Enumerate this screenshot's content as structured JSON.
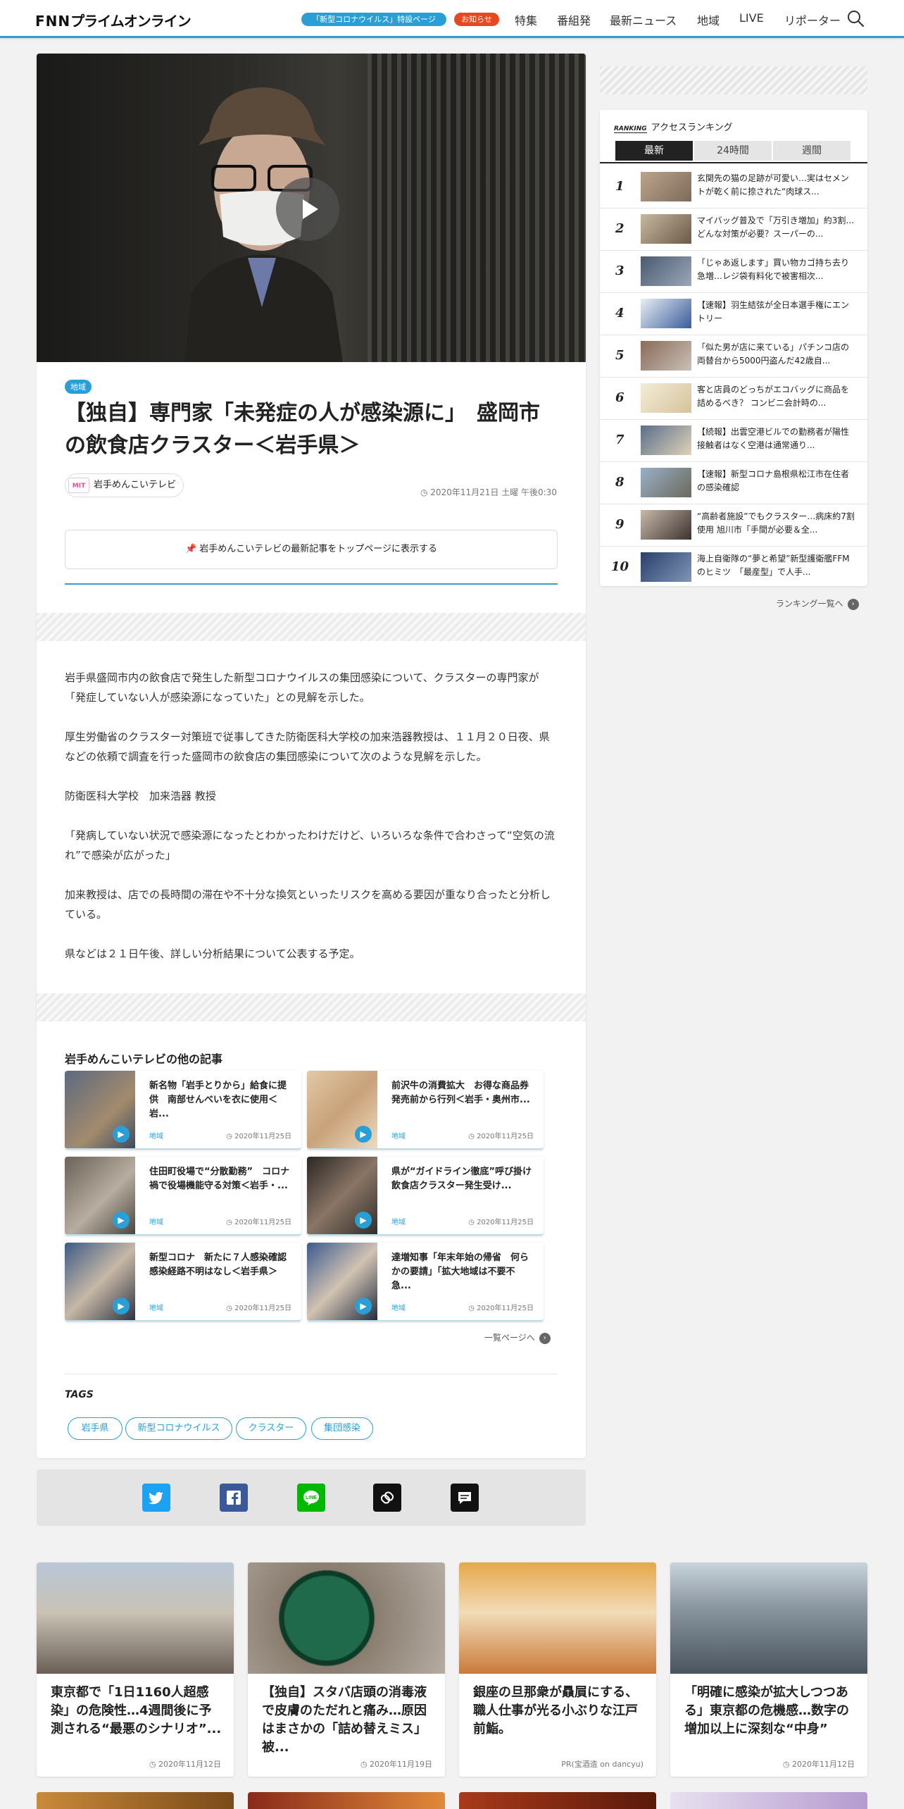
{
  "header": {
    "logo_fnn": "FNN",
    "logo_text": "プライムオンライン",
    "pill_corona": "「新型コロナウイルス」特設ページ",
    "pill_notice": "お知らせ",
    "nav": [
      "特集",
      "番組発",
      "最新ニュース",
      "地域",
      "LIVE",
      "リポーター"
    ]
  },
  "article": {
    "category": "地域",
    "title": "【独自】専門家「未発症の人が感染源に」　盛岡市の飲食店クラスター＜岩手県＞",
    "source_logo": "MIT",
    "source_name": "岩手めんこいテレビ",
    "date": "2020年11月21日 土曜 午後0:30",
    "pin_text": "岩手めんこいテレビの最新記事をトップページに表示する",
    "paragraphs": [
      "岩手県盛岡市内の飲食店で発生した新型コロナウイルスの集団感染について、クラスターの専門家が「発症していない人が感染源になっていた」との見解を示した。",
      "厚生労働省のクラスター対策班で従事してきた防衛医科大学校の加来浩器教授は、１１月２０日夜、県などの依頼で調査を行った盛岡市の飲食店の集団感染について次のような見解を示した。",
      "防衛医科大学校　加来浩器 教授",
      "「発病していない状況で感染源になったとわかったわけだけど、いろいろな条件で合わさって“空気の流れ”で感染が広がった」",
      "加来教授は、店での長時間の滞在や不十分な換気といったリスクを高める要因が重なり合ったと分析している。",
      "県などは２１日午後、詳しい分析結果について公表する予定。"
    ]
  },
  "related": {
    "heading": "岩手めんこいテレビの他の記事",
    "items": [
      {
        "title": "新名物「岩手とりから」給食に提供　南部せんべいを衣に使用＜岩...",
        "category": "地域",
        "date": "2020年11月25日"
      },
      {
        "title": "前沢牛の消費拡大　お得な商品券　発売前から行列＜岩手・奥州市...",
        "category": "地域",
        "date": "2020年11月25日"
      },
      {
        "title": "住田町役場で“分散勤務”　コロナ禍で役場機能守る対策＜岩手・...",
        "category": "地域",
        "date": "2020年11月25日"
      },
      {
        "title": "県が“ガイドライン徹底”呼び掛け　飲食店クラスター発生受け...",
        "category": "地域",
        "date": "2020年11月25日"
      },
      {
        "title": "新型コロナ　新たに７人感染確認　感染経路不明はなし＜岩手県＞",
        "category": "地域",
        "date": "2020年11月25日"
      },
      {
        "title": "達増知事「年末年始の帰省　何らかの要請」「拡大地域は不要不急...",
        "category": "地域",
        "date": "2020年11月25日"
      }
    ],
    "more": "一覧ページへ"
  },
  "tags": {
    "label": "TAGS",
    "items": [
      "岩手県",
      "新型コロナウイルス",
      "クラスター",
      "集団感染"
    ]
  },
  "share": [
    "twitter-icon",
    "facebook-icon",
    "line-icon",
    "copy-link-icon",
    "comment-icon"
  ],
  "ranking": {
    "badge": "RANKING",
    "title": "アクセスランキング",
    "tabs": [
      "最新",
      "24時間",
      "週間"
    ],
    "items": [
      {
        "rank": "1",
        "text": "玄関先の猫の足跡が可愛い…実はセメントが乾く前に捺された“肉球ス..."
      },
      {
        "rank": "2",
        "text": "マイバッグ普及で「万引き増加」約3割…どんな対策が必要？スーパーの..."
      },
      {
        "rank": "3",
        "text": "「じゃあ返します」買い物カゴ持ち去り急増…レジ袋有料化で被害相次..."
      },
      {
        "rank": "4",
        "text": "【速報】羽生結弦が全日本選手権にエントリー"
      },
      {
        "rank": "5",
        "text": "「似た男が店に来ている」パチンコ店の両替台から5000円盗んだ42歳自..."
      },
      {
        "rank": "6",
        "text": "客と店員のどっちがエコバッグに商品を詰めるべき？ コンビニ会計時の..."
      },
      {
        "rank": "7",
        "text": "【続報】出雲空港ビルでの勤務者が陽性　接触者はなく空港は通常通り..."
      },
      {
        "rank": "8",
        "text": "【速報】新型コロナ島根県松江市在住者の感染確認"
      },
      {
        "rank": "9",
        "text": "“高齢者施設”でもクラスター…病床約7割使用 旭川市「手間が必要＆全..."
      },
      {
        "rank": "10",
        "text": "海上自衛隊の“夢と希望”新型護衛艦FFMのヒミツ　「最産型」で人手..."
      }
    ],
    "more": "ランキング一覧へ"
  },
  "bottom_cards": [
    {
      "title": "東京都で「1日1160人超感染」の危険性…4週間後に予測される“最悪のシナリオ”...",
      "date": "2020年11月12日"
    },
    {
      "title": "【独自】スタバ店頭の消毒液で皮膚のただれと痛み…原因はまさかの「詰め替えミス」被...",
      "date": "2020年11月19日"
    },
    {
      "title": "銀座の旦那衆が贔屓にする、職人仕事が光る小ぶりな江戸前鮨。",
      "date": "PR(宝酒造 on dancyu)"
    },
    {
      "title": "「明確に感染が拡大しつつある」東京都の危機感…数字の増加以上に深刻な“中身”",
      "date": "2020年11月12日"
    }
  ],
  "colors": {
    "accent": "#2a9fd6",
    "notice": "#e8481f",
    "twitter": "#1da1f2",
    "facebook": "#3b5998",
    "line": "#00b900"
  }
}
